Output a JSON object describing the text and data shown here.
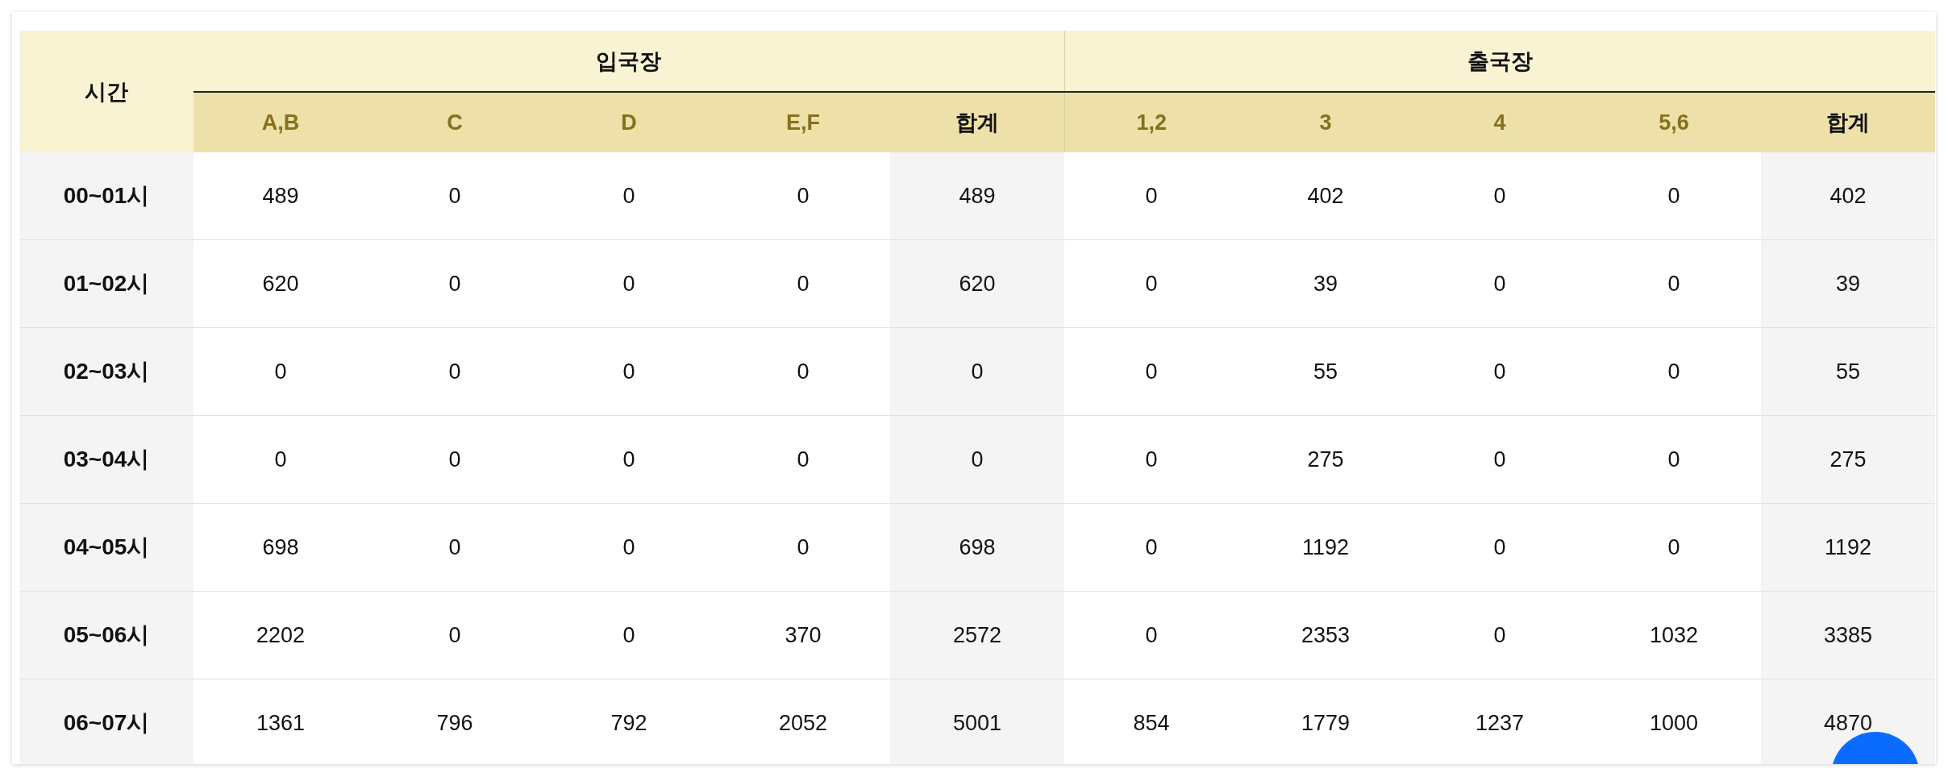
{
  "table": {
    "time_label": "시간",
    "groups": [
      {
        "label": "입국장",
        "columns": [
          {
            "label": "A,B",
            "kind": "gate"
          },
          {
            "label": "C",
            "kind": "gate"
          },
          {
            "label": "D",
            "kind": "gate"
          },
          {
            "label": "E,F",
            "kind": "gate"
          },
          {
            "label": "합계",
            "kind": "total"
          }
        ]
      },
      {
        "label": "출국장",
        "columns": [
          {
            "label": "1,2",
            "kind": "gate"
          },
          {
            "label": "3",
            "kind": "gate"
          },
          {
            "label": "4",
            "kind": "gate"
          },
          {
            "label": "5,6",
            "kind": "gate"
          },
          {
            "label": "합계",
            "kind": "total"
          }
        ]
      }
    ],
    "rows": [
      {
        "time": "00~01시",
        "cells": [
          "489",
          "0",
          "0",
          "0",
          "489",
          "0",
          "402",
          "0",
          "0",
          "402"
        ]
      },
      {
        "time": "01~02시",
        "cells": [
          "620",
          "0",
          "0",
          "0",
          "620",
          "0",
          "39",
          "0",
          "0",
          "39"
        ]
      },
      {
        "time": "02~03시",
        "cells": [
          "0",
          "0",
          "0",
          "0",
          "0",
          "0",
          "55",
          "0",
          "0",
          "55"
        ]
      },
      {
        "time": "03~04시",
        "cells": [
          "0",
          "0",
          "0",
          "0",
          "0",
          "0",
          "275",
          "0",
          "0",
          "275"
        ]
      },
      {
        "time": "04~05시",
        "cells": [
          "698",
          "0",
          "0",
          "0",
          "698",
          "0",
          "1192",
          "0",
          "0",
          "1192"
        ]
      },
      {
        "time": "05~06시",
        "cells": [
          "2202",
          "0",
          "0",
          "370",
          "2572",
          "0",
          "2353",
          "0",
          "1032",
          "3385"
        ]
      },
      {
        "time": "06~07시",
        "cells": [
          "1361",
          "796",
          "792",
          "2052",
          "5001",
          "854",
          "1779",
          "1237",
          "1000",
          "4870"
        ]
      }
    ]
  }
}
